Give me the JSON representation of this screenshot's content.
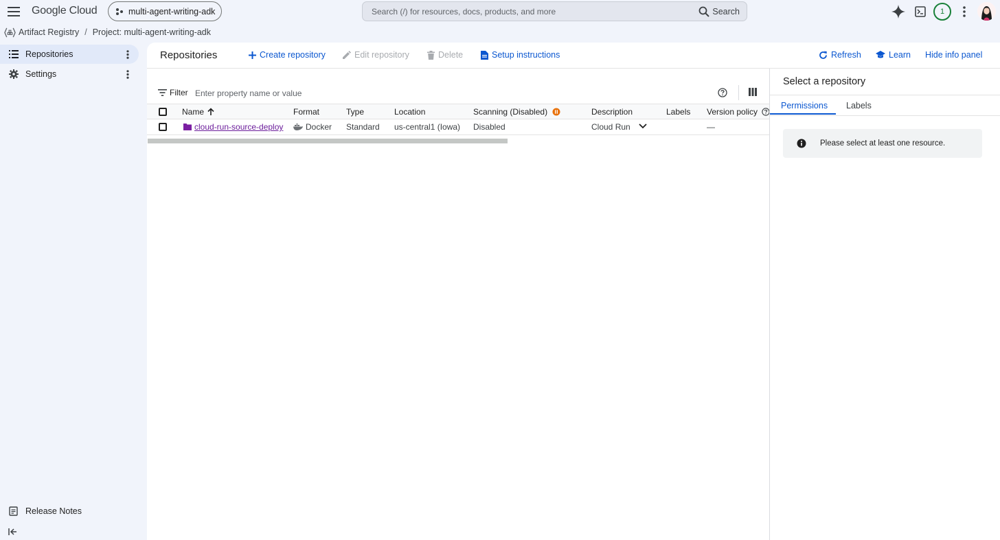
{
  "header": {
    "brand": "Google Cloud",
    "project": "multi-agent-writing-adk",
    "search_placeholder": "Search (/) for resources, docs, products, and more",
    "search_button": "Search",
    "notification_count": "1"
  },
  "breadcrumb": {
    "service": "Artifact Registry",
    "project": "Project: multi-agent-writing-adk"
  },
  "sidebar": {
    "items": [
      {
        "label": "Repositories",
        "icon": "list-icon",
        "active": true
      },
      {
        "label": "Settings",
        "icon": "gear-icon",
        "active": false
      }
    ],
    "release_notes": "Release Notes"
  },
  "toolbar": {
    "title": "Repositories",
    "create": "Create repository",
    "edit": "Edit repository",
    "delete": "Delete",
    "setup": "Setup instructions",
    "refresh": "Refresh",
    "learn": "Learn",
    "hide_panel": "Hide info panel"
  },
  "filter": {
    "label": "Filter",
    "placeholder": "Enter property name or value"
  },
  "table": {
    "columns": {
      "name": "Name",
      "format": "Format",
      "type": "Type",
      "location": "Location",
      "scanning": "Scanning (Disabled)",
      "description": "Description",
      "labels": "Labels",
      "version_policy": "Version policy"
    },
    "rows": [
      {
        "name": "cloud-run-source-deploy",
        "format": "Docker",
        "type": "Standard",
        "location": "us-central1 (Iowa)",
        "scanning": "Disabled",
        "description": "Cloud Run",
        "labels": "",
        "version_policy": "—"
      }
    ]
  },
  "info_panel": {
    "title": "Select a repository",
    "tabs": [
      "Permissions",
      "Labels"
    ],
    "active_tab": "Permissions",
    "message": "Please select at least one resource."
  },
  "colors": {
    "accent": "#0b57d0",
    "nav_active": "#e1e9f9",
    "repo_link": "#6a1b9a",
    "scanning_warning": "#e8710a",
    "notification": "#188038"
  }
}
